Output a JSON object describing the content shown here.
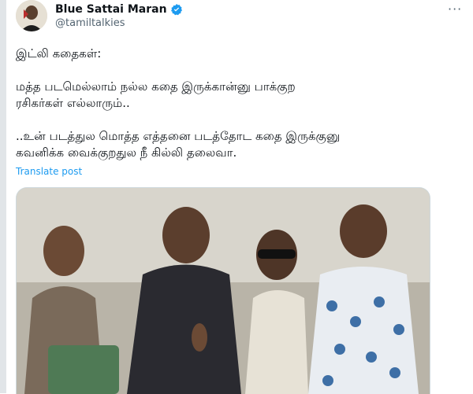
{
  "post": {
    "author": {
      "display_name": "Blue Sattai Maran",
      "handle": "@tamiltalkies",
      "verified": true
    },
    "more_icon": "more-horizontal-icon",
    "text_lines": [
      "இட்லி கதைகள்:",
      "",
      "மத்த படமெல்லாம் நல்ல கதை இருக்கான்னு பாக்குற",
      "ரசிகர்கள் எல்லாரும்..",
      "",
      "..உன் படத்துல மொத்த எத்தனை படத்தோட கதை இருக்குனு",
      "கவனிக்க வைக்குறதுல நீ கில்லி தலைவா."
    ],
    "translate_label": "Translate post"
  },
  "colors": {
    "text": "#0f1419",
    "secondary": "#536471",
    "link": "#1d9bf0",
    "verified": "#1d9bf0"
  }
}
